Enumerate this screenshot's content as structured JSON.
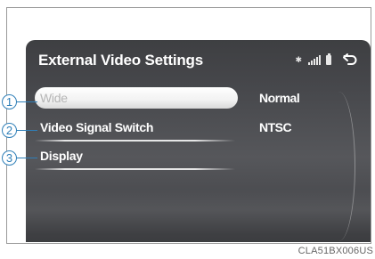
{
  "screen": {
    "title": "External Video Settings",
    "status_icons": [
      "bluetooth-icon",
      "signal-strength-icon",
      "battery-icon",
      "back-icon"
    ],
    "items": [
      {
        "label": "Wide",
        "value": "Normal",
        "selected": true
      },
      {
        "label": "Video Signal Switch",
        "value": "NTSC",
        "selected": false
      },
      {
        "label": "Display",
        "value": "",
        "selected": false
      }
    ]
  },
  "callouts": [
    "1",
    "2",
    "3"
  ],
  "figure_code": "CLA51BX006US",
  "colors": {
    "accent": "#2f7fb8",
    "screen_bg": "#46474b",
    "text": "#ffffff"
  }
}
